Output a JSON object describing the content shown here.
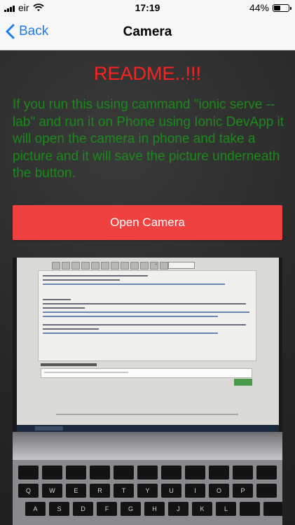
{
  "status_bar": {
    "carrier": "eir",
    "time": "17:19",
    "battery": "44%",
    "battery_level": 0.44
  },
  "nav": {
    "back_label": "Back",
    "title": "Camera"
  },
  "content": {
    "heading": "README..!!!",
    "description": "If you run this using cammand \"ionic serve --lab\" and run it on Phone using Ionic DevApp it will open the camera in phone and take a picture and it will save the picture underneath the button.",
    "button_label": "Open Camera"
  },
  "photo": {
    "keyboard_rows": [
      [
        "",
        "",
        "",
        "",
        "",
        "",
        "",
        "",
        "",
        "",
        ""
      ],
      [
        "Q",
        "W",
        "E",
        "R",
        "T",
        "Y",
        "U",
        "I",
        "O",
        "P",
        ""
      ],
      [
        "A",
        "S",
        "D",
        "F",
        "G",
        "H",
        "J",
        "K",
        "L",
        "",
        ""
      ]
    ]
  },
  "colors": {
    "accent": "#1e7cf0",
    "heading": "#ff2020",
    "text": "#1a8a1a",
    "button": "#f04141"
  }
}
